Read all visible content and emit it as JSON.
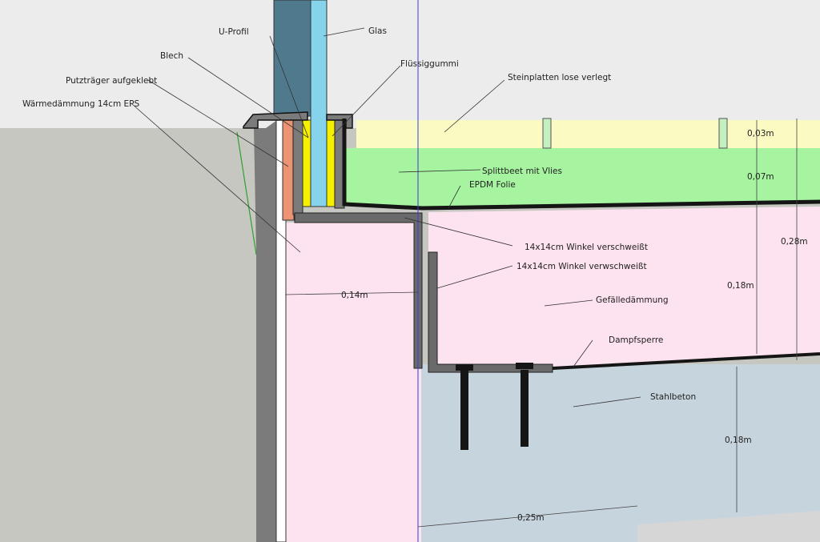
{
  "colors": {
    "sky": "#ececec",
    "ground": "#c7c7c2",
    "wall_dark": "#7b7b7b",
    "glass_frame": "#4f7a8e",
    "glass": "#86d4ec",
    "yellow": "#f6ef00",
    "orange": "#ec9374",
    "stone": "#fbfac3",
    "gravel": "#a6f3a0",
    "insulation": "#fde2f0",
    "concrete": "#c6d4de",
    "steel": "#6a6a6a",
    "line": "#151515"
  },
  "labels": {
    "u_profil": "U-Profil",
    "glas": "Glas",
    "blech": "Blech",
    "fluessiggummi": "Flüssiggummi",
    "putztraeger": "Putzträger aufgeklebt",
    "steinplatten": "Steinplatten lose verlegt",
    "waermedaemmung": "Wärmedämmung 14cm EPS",
    "splittbeet": "Splittbeet mit Vlies",
    "epdm": "EPDM Folie",
    "winkel_verschweisst": "14x14cm Winkel verschweißt",
    "winkel_verwschweisst": "14x14cm Winkel verwschweißt",
    "gefaelledaemmung": "Gefälledämmung",
    "dampfsperre": "Dampfsperre",
    "stahlbeton": "Stahlbeton"
  },
  "dimensions": {
    "d_003": "0,03m",
    "d_007": "0,07m",
    "d_028": "0,28m",
    "d_018_upper": "0,18m",
    "d_014": "0,14m",
    "d_018_lower": "0,18m",
    "d_025": "0,25m"
  }
}
